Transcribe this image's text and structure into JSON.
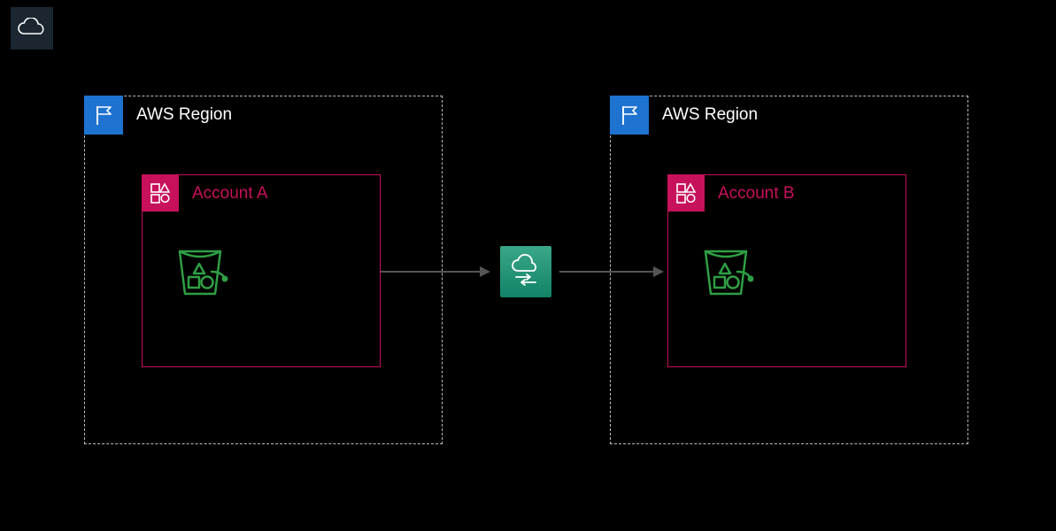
{
  "diagram": {
    "cloud_icon": "cloud",
    "regions": [
      {
        "label": "AWS Region",
        "account_label": "Account A"
      },
      {
        "label": "AWS Region",
        "account_label": "Account B"
      }
    ],
    "transfer_service": "AWS DataSync"
  }
}
